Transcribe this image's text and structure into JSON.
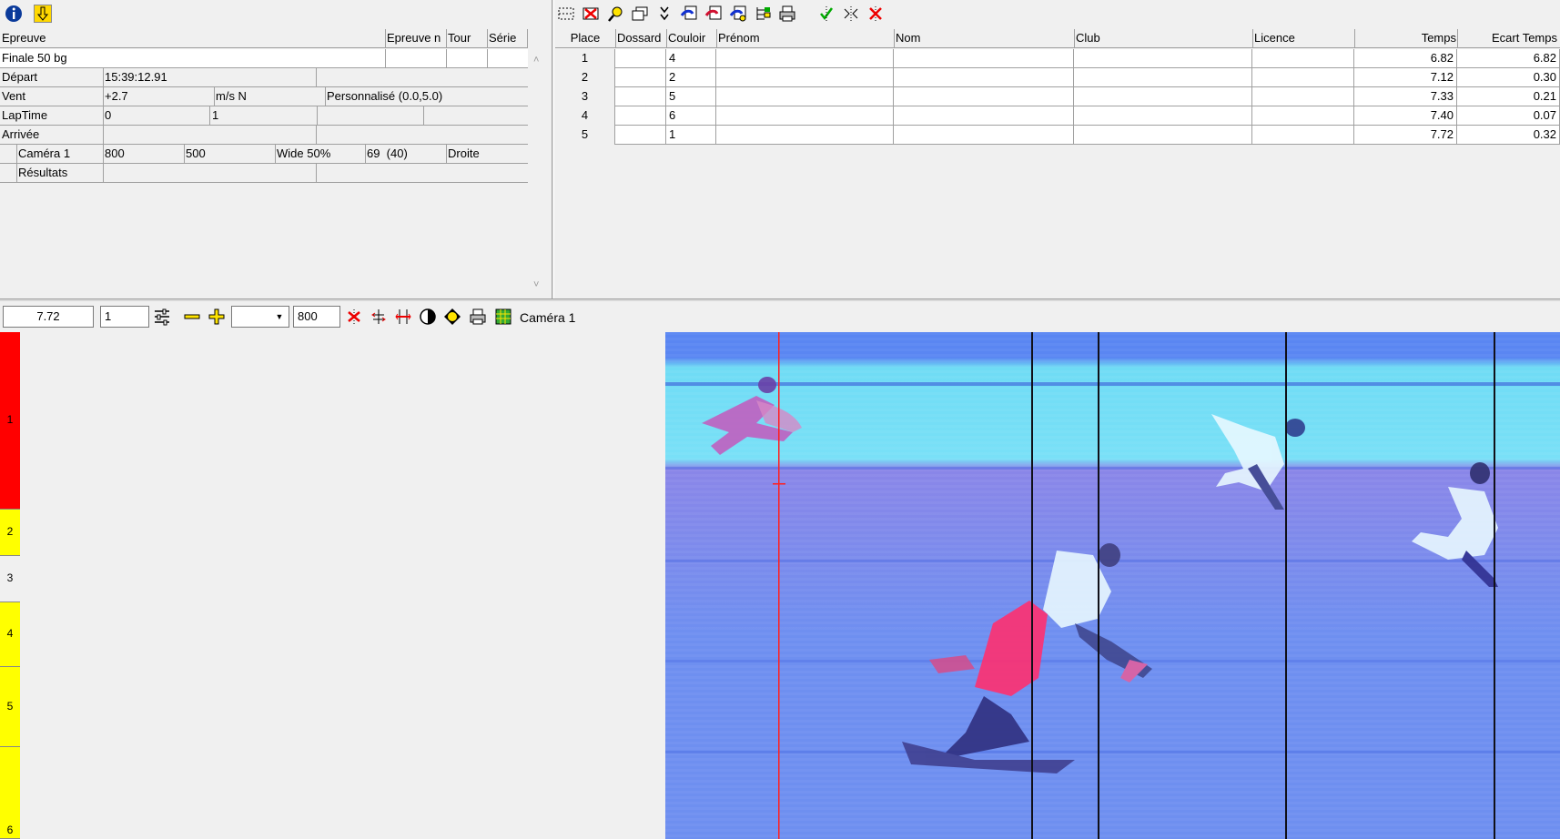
{
  "left_toolbar": {
    "icons": [
      "info-icon",
      "download-arrow-icon"
    ]
  },
  "event_table": {
    "headers": [
      "Epreuve",
      "Epreuve n",
      "Tour",
      "Série"
    ],
    "event_name": "Finale 50 bg",
    "rows": [
      {
        "label": "Départ",
        "c1": "15:39:12.91",
        "c2": "",
        "c3": "",
        "c4": ""
      },
      {
        "label": "Vent",
        "c1": "+2.7",
        "c2": "m/s N",
        "c3": "Personnalisé (0.0,5.0)",
        "c4": ""
      },
      {
        "label": "LapTime",
        "c1": "0",
        "c2": "1",
        "c3": "",
        "c4": ""
      },
      {
        "label": "Arrivée",
        "c1": "",
        "c2": "",
        "c3": "",
        "c4": ""
      }
    ],
    "camera_row": {
      "label": "Caméra 1",
      "c1": "800",
      "c2": "500",
      "c3": "Wide 50%",
      "c4": "69  (40)",
      "c5": "Droite"
    },
    "results_row": {
      "label": "Résultats"
    }
  },
  "results_table": {
    "headers": [
      "Place",
      "Dossard",
      "Couloir",
      "Prénom",
      "Nom",
      "Club",
      "Licence",
      "Temps",
      "Ecart Temps"
    ],
    "rows": [
      {
        "place": "1",
        "dossard": "",
        "couloir": "4",
        "prenom": "",
        "nom": "",
        "club": "",
        "licence": "",
        "temps": "6.82",
        "ecart": "6.82"
      },
      {
        "place": "2",
        "dossard": "",
        "couloir": "2",
        "prenom": "",
        "nom": "",
        "club": "",
        "licence": "",
        "temps": "7.12",
        "ecart": "0.30"
      },
      {
        "place": "3",
        "dossard": "",
        "couloir": "5",
        "prenom": "",
        "nom": "",
        "club": "",
        "licence": "",
        "temps": "7.33",
        "ecart": "0.21"
      },
      {
        "place": "4",
        "dossard": "",
        "couloir": "6",
        "prenom": "",
        "nom": "",
        "club": "",
        "licence": "",
        "temps": "7.40",
        "ecart": "0.07"
      },
      {
        "place": "5",
        "dossard": "",
        "couloir": "1",
        "prenom": "",
        "nom": "",
        "club": "",
        "licence": "",
        "temps": "7.72",
        "ecart": "0.32"
      }
    ]
  },
  "photo_toolbar": {
    "time_value": "7.72",
    "field_value": "1",
    "density_value": "800",
    "camera_label": "Caméra 1"
  },
  "lanes": [
    {
      "label": "1",
      "color": "#ff0000"
    },
    {
      "label": "2",
      "color": "#ffff00"
    },
    {
      "label": "3",
      "color": "#f0f0f0"
    },
    {
      "label": "4",
      "color": "#ffff00"
    },
    {
      "label": "5",
      "color": "#ffff00"
    },
    {
      "label": "6",
      "color": "#ffff00"
    }
  ],
  "colors": {
    "photo_blue": "#6a8ff0",
    "photo_cyan": "#6fdcf5",
    "cursor_red": "#ff2020"
  }
}
